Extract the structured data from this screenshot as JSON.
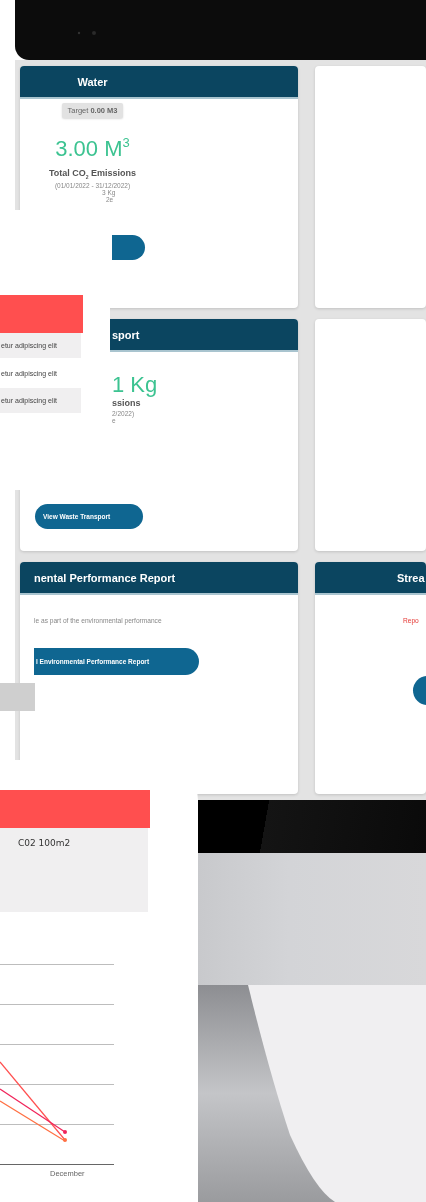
{
  "monitor_screen": {
    "cards": [
      {
        "kind": "metric",
        "header": "Water",
        "target": "Target **0.00 M3**",
        "value": "3.00 M$^{3}$",
        "label": "Total CO$_{2}$ Emissions",
        "period": "(01/01/2022 - 31/12/2022)",
        "lines": [
          "3 Kg",
          "2e"
        ]
      },
      {
        "kind": "blank"
      },
      {
        "kind": "metric",
        "header": "sport",
        "value": "1 Kg",
        "label": "ssions",
        "period": "2/2022)",
        "lines": [
          "e"
        ],
        "button": "View Waste Transport"
      },
      {
        "kind": "blank"
      },
      {
        "kind": "report",
        "header": "nental Performance Report",
        "text": "le as part of the environmental performance",
        "alert": false,
        "button": "l Environmental Performance Report"
      },
      {
        "kind": "report",
        "header": "Strea",
        "text": "Repo",
        "alert": true
      }
    ]
  },
  "overlay_list": {
    "rows": [
      "etur adipiscing elit",
      "etur adipiscing elit",
      "etur adipiscing elit"
    ]
  },
  "overlay_chart": {
    "table_cell": "C02 100m2",
    "x_label": "December"
  }
}
